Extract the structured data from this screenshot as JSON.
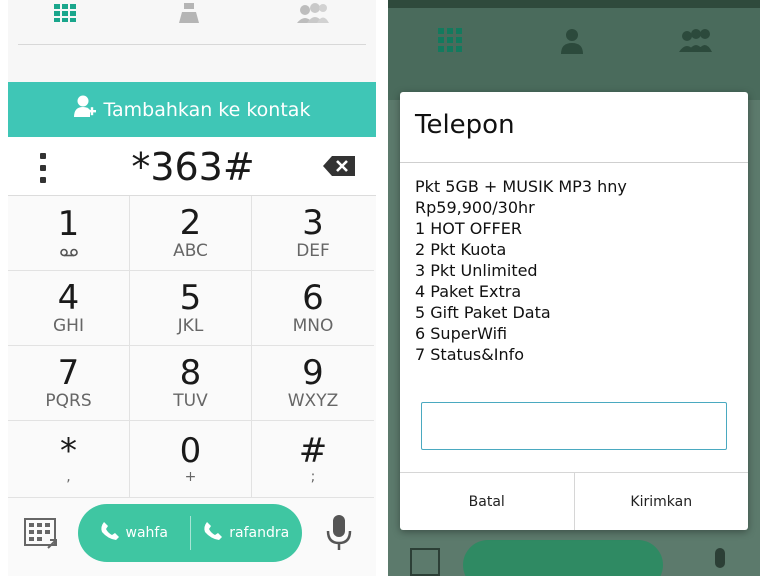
{
  "left": {
    "top_tabs": [
      {
        "name": "dialpad-tab",
        "icon": "dialpad-icon"
      },
      {
        "name": "contacts-tab",
        "icon": "person-icon"
      },
      {
        "name": "groups-tab",
        "icon": "group-icon"
      }
    ],
    "add_contact_label": "Tambahkan ke kontak",
    "dialed_number": "*363#",
    "keys": [
      {
        "digit": "1",
        "letters": ""
      },
      {
        "digit": "2",
        "letters": "ABC"
      },
      {
        "digit": "3",
        "letters": "DEF"
      },
      {
        "digit": "4",
        "letters": "GHI"
      },
      {
        "digit": "5",
        "letters": "JKL"
      },
      {
        "digit": "6",
        "letters": "MNO"
      },
      {
        "digit": "7",
        "letters": "PQRS"
      },
      {
        "digit": "8",
        "letters": "TUV"
      },
      {
        "digit": "9",
        "letters": "WXYZ"
      },
      {
        "digit": "*",
        "letters": ","
      },
      {
        "digit": "0",
        "letters": "+"
      },
      {
        "digit": "#",
        "letters": ";"
      }
    ],
    "call_buttons": [
      "wahfa",
      "rafandra"
    ]
  },
  "dialog": {
    "title": "Telepon",
    "message_lines": [
      "Pkt 5GB + MUSIK MP3 hny",
      "Rp59,900/30hr",
      "1 HOT OFFER",
      "2 Pkt Kuota",
      "3 Pkt Unlimited",
      "4 Paket Extra",
      "5 Gift Paket Data",
      "6 SuperWifi",
      "7 Status&Info"
    ],
    "input_value": "",
    "cancel_label": "Batal",
    "send_label": "Kirimkan"
  },
  "colors": {
    "accent": "#3fc6b6",
    "call_green": "#3fc6a2",
    "icon_teal": "#1aa68c"
  }
}
